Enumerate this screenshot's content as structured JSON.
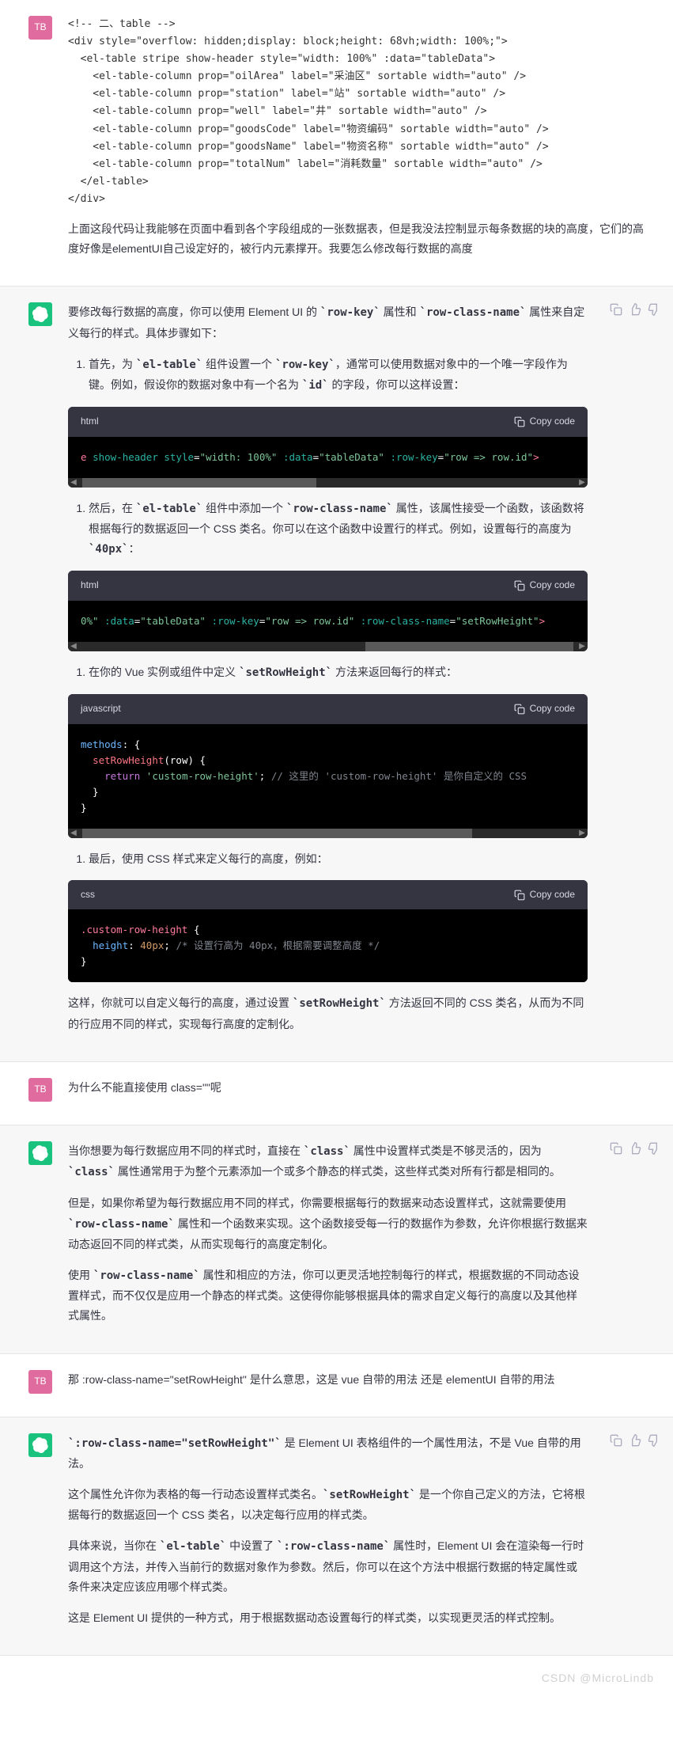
{
  "avatars": {
    "user_initials": "TB"
  },
  "actions": {
    "copy_label": "Copy code"
  },
  "msg1": {
    "code": "<!-- 二、table -->\n<div style=\"overflow: hidden;display: block;height: 68vh;width: 100%;\">\n  <el-table stripe show-header style=\"width: 100%\" :data=\"tableData\">\n    <el-table-column prop=\"oilArea\" label=\"采油区\" sortable width=\"auto\" />\n    <el-table-column prop=\"station\" label=\"站\" sortable width=\"auto\" />\n    <el-table-column prop=\"well\" label=\"井\" sortable width=\"auto\" />\n    <el-table-column prop=\"goodsCode\" label=\"物资编码\" sortable width=\"auto\" />\n    <el-table-column prop=\"goodsName\" label=\"物资名称\" sortable width=\"auto\" />\n    <el-table-column prop=\"totalNum\" label=\"消耗数量\" sortable width=\"auto\" />\n  </el-table>\n</div>",
    "para": "上面这段代码让我能够在页面中看到各个字段组成的一张数据表，但是我没法控制显示每条数据的块的高度，它们的高度好像是elementUI自己设定好的，被行内元素撑开。我要怎么修改每行数据的高度"
  },
  "msg2": {
    "p1_a": "要修改每行数据的高度，你可以使用 Element UI 的 ",
    "p1_code1": "`row-key`",
    "p1_b": " 属性和 ",
    "p1_code2": "`row-class-name`",
    "p1_c": " 属性来自定义每行的样式。具体步骤如下：",
    "li1_a": "首先，为 ",
    "li1_code1": "`el-table`",
    "li1_b": " 组件设置一个 ",
    "li1_code2": "`row-key`",
    "li1_c": "，通常可以使用数据对象中的一个唯一字段作为键。例如，假设你的数据对象中有一个名为 ",
    "li1_code3": "`id`",
    "li1_d": " 的字段，你可以这样设置：",
    "code1_lang": "html",
    "li2_a": "然后，在 ",
    "li2_code1": "`el-table`",
    "li2_b": " 组件中添加一个 ",
    "li2_code2": "`row-class-name`",
    "li2_c": " 属性，该属性接受一个函数，该函数将根据每行的数据返回一个 CSS 类名。你可以在这个函数中设置行的样式。例如，设置每行的高度为 ",
    "li2_code3": "`40px`",
    "li2_d": "：",
    "code2_lang": "html",
    "li3_a": "在你的 Vue 实例或组件中定义 ",
    "li3_code1": "`setRowHeight`",
    "li3_b": " 方法来返回每行的样式：",
    "code3_lang": "javascript",
    "li4_a": "最后，使用 CSS 样式来定义每行的高度，例如：",
    "code4_lang": "css",
    "p2_a": "这样，你就可以自定义每行的高度，通过设置 ",
    "p2_code1": "`setRowHeight`",
    "p2_b": " 方法返回不同的 CSS 类名，从而为不同的行应用不同的样式，实现每行高度的定制化。"
  },
  "msg3": {
    "text": "为什么不能直接使用 class=\"\"呢"
  },
  "msg4": {
    "p1_a": "当你想要为每行数据应用不同的样式时，直接在 ",
    "p1_code1": "`class`",
    "p1_b": " 属性中设置样式类是不够灵活的，因为 ",
    "p1_code2": "`class`",
    "p1_c": " 属性通常用于为整个元素添加一个或多个静态的样式类，这些样式类对所有行都是相同的。",
    "p2_a": "但是，如果你希望为每行数据应用不同的样式，你需要根据每行的数据来动态设置样式，这就需要使用 ",
    "p2_code1": "`row-class-name`",
    "p2_b": " 属性和一个函数来实现。这个函数接受每一行的数据作为参数，允许你根据行数据来动态返回不同的样式类，从而实现每行的高度定制化。",
    "p3_a": "使用 ",
    "p3_code1": "`row-class-name`",
    "p3_b": " 属性和相应的方法，你可以更灵活地控制每行的样式，根据数据的不同动态设置样式，而不仅仅是应用一个静态的样式类。这使得你能够根据具体的需求自定义每行的高度以及其他样式属性。"
  },
  "msg5": {
    "text": "那 :row-class-name=\"setRowHeight\" 是什么意思，这是 vue 自带的用法 还是 elementUI 自带的用法"
  },
  "msg6": {
    "p1_code1": "`:row-class-name=\"setRowHeight\"`",
    "p1_a": " 是 Element UI 表格组件的一个属性用法，不是 Vue 自带的用法。",
    "p2_a": "这个属性允许你为表格的每一行动态设置样式类名。",
    "p2_code1": "`setRowHeight`",
    "p2_b": " 是一个你自己定义的方法，它将根据每行的数据返回一个 CSS 类名，以决定每行应用的样式类。",
    "p3_a": "具体来说，当你在 ",
    "p3_code1": "`el-table`",
    "p3_b": " 中设置了 ",
    "p3_code2": "`:row-class-name`",
    "p3_c": " 属性时，Element UI 会在渲染每一行时调用这个方法，并传入当前行的数据对象作为参数。然后，你可以在这个方法中根据行数据的特定属性或条件来决定应该应用哪个样式类。",
    "p4": "这是 Element UI 提供的一种方式，用于根据数据动态设置每行的样式类，以实现更灵活的样式控制。"
  },
  "footer": "CSDN @MicroLindb"
}
